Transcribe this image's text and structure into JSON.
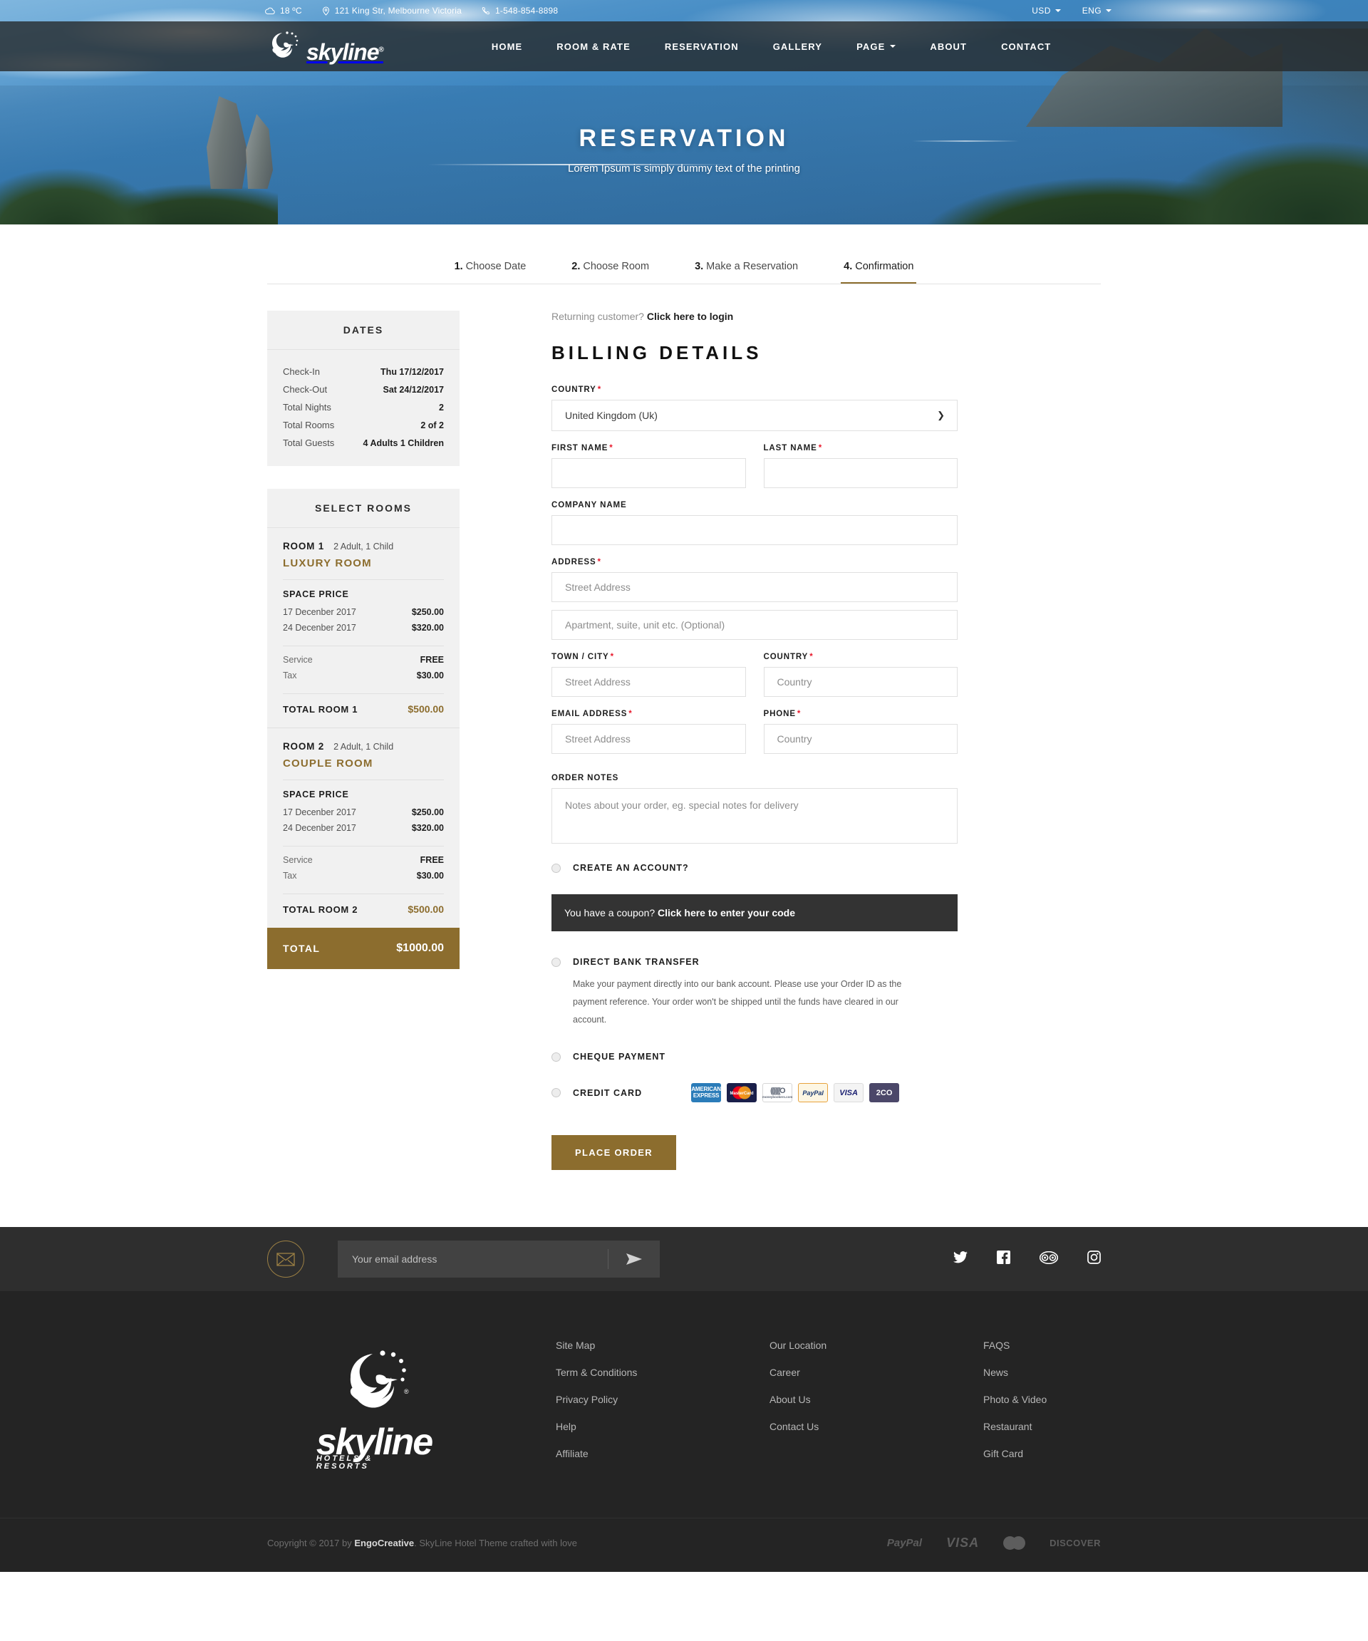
{
  "topbar": {
    "weather": "18 ºC",
    "address": "121 King Str, Melbourne Victoria",
    "phone": "1-548-854-8898",
    "currency": "USD",
    "language": "ENG"
  },
  "brand": {
    "name": "skyline",
    "registered": "®",
    "tagline": "HOTELS & RESORTS"
  },
  "nav": {
    "items": [
      {
        "label": "HOME",
        "has_caret": false
      },
      {
        "label": "ROOM & RATE",
        "has_caret": false
      },
      {
        "label": "RESERVATION",
        "has_caret": false
      },
      {
        "label": "GALLERY",
        "has_caret": false
      },
      {
        "label": "PAGE",
        "has_caret": true
      },
      {
        "label": "ABOUT",
        "has_caret": false
      },
      {
        "label": "CONTACT",
        "has_caret": false
      }
    ]
  },
  "hero": {
    "title": "RESERVATION",
    "subtitle": "Lorem Ipsum is simply dummy text of the printing"
  },
  "steps": [
    {
      "num": "1.",
      "label": "Choose Date",
      "active": false
    },
    {
      "num": "2.",
      "label": "Choose Room",
      "active": false
    },
    {
      "num": "3.",
      "label": "Make a Reservation",
      "active": false
    },
    {
      "num": "4.",
      "label": "Confirmation",
      "active": true
    }
  ],
  "dates_panel": {
    "title": "DATES",
    "rows": [
      {
        "label": "Check-In",
        "value": "Thu 17/12/2017"
      },
      {
        "label": "Check-Out",
        "value": "Sat 24/12/2017"
      },
      {
        "label": "Total Nights",
        "value": "2"
      },
      {
        "label": "Total Rooms",
        "value": "2 of 2"
      },
      {
        "label": "Total Guests",
        "value": "4 Adults 1 Children"
      }
    ]
  },
  "rooms_panel": {
    "title": "SELECT ROOMS",
    "space_price_label": "SPACE PRICE",
    "rooms": [
      {
        "number": "ROOM 1",
        "occupancy": "2 Adult, 1 Child",
        "name": "LUXURY ROOM",
        "nights": [
          {
            "date": "17 Decenber 2017",
            "price": "$250.00"
          },
          {
            "date": "24 Decenber 2017",
            "price": "$320.00"
          }
        ],
        "service_label": "Service",
        "service_value": "FREE",
        "tax_label": "Tax",
        "tax_value": "$30.00",
        "total_label": "TOTAL ROOM 1",
        "total_value": "$500.00"
      },
      {
        "number": "ROOM 2",
        "occupancy": "2 Adult, 1 Child",
        "name": "COUPLE ROOM",
        "nights": [
          {
            "date": "17 Decenber 2017",
            "price": "$250.00"
          },
          {
            "date": "24 Decenber 2017",
            "price": "$320.00"
          }
        ],
        "service_label": "Service",
        "service_value": "FREE",
        "tax_label": "Tax",
        "tax_value": "$30.00",
        "total_label": "TOTAL ROOM 2",
        "total_value": "$500.00"
      }
    ],
    "grand_total_label": "TOTAL",
    "grand_total_value": "$1000.00"
  },
  "billing": {
    "returning_prefix": "Returning customer? ",
    "returning_link": "Click here to login",
    "title": "BILLING DETAILS",
    "country_label": "COUNTRY",
    "country_value": "United Kingdom (Uk)",
    "country_options": [
      "United Kingdom (Uk)"
    ],
    "first_name_label": "FIRST NAME",
    "first_name_value": "",
    "last_name_label": "LAST NAME",
    "last_name_value": "",
    "company_label": "COMPANY NAME",
    "company_value": "",
    "address_label": "ADDRESS",
    "address_placeholder": "Street Address",
    "address2_placeholder": "Apartment, suite, unit etc. (Optional)",
    "town_label": "TOWN / CITY",
    "town_placeholder": "Street Address",
    "country2_label": "COUNTRY",
    "country2_placeholder": "Country",
    "email_label": "EMAIL ADDRESS",
    "email_placeholder": "Street Address",
    "phone_label": "PHONE",
    "phone_placeholder": "Country",
    "notes_label": "ORDER NOTES",
    "notes_placeholder": "Notes about your order, eg. special notes for delivery",
    "create_account_label": "CREATE AN ACCOUNT?",
    "coupon_prefix": "You have a coupon? ",
    "coupon_link": "Click here to enter your code",
    "place_order_label": "PLACE ORDER"
  },
  "payments": {
    "bank_label": "DIRECT BANK TRANSFER",
    "bank_desc": "Make your payment directly into our bank account. Please use your Order ID as the payment reference. Your order won't be shipped until the funds have cleared in our account.",
    "cheque_label": "CHEQUE PAYMENT",
    "credit_label": "CREDIT CARD",
    "card_icons": [
      {
        "name": "amex-icon",
        "line1": "AMERICAN",
        "line2": "EXPRESS"
      },
      {
        "name": "mastercard-icon",
        "line1": "MasterCard",
        "line2": ""
      },
      {
        "name": "moneybookers-icon",
        "line1": "((((((O",
        "line2": "moneybookers.com"
      },
      {
        "name": "paypal-icon",
        "line1": "PayPal",
        "line2": ""
      },
      {
        "name": "visa-icon",
        "line1": "VISA",
        "line2": ""
      },
      {
        "name": "2checkout-icon",
        "line1": "2CO",
        "line2": ""
      }
    ]
  },
  "newsletter": {
    "placeholder": "Your email address",
    "value": "",
    "socials": [
      "twitter-icon",
      "facebook-icon",
      "tripadvisor-icon",
      "instagram-icon"
    ]
  },
  "footer": {
    "columns": [
      {
        "links": [
          "Site Map",
          "Term & Conditions",
          "Privacy Policy",
          "Help",
          "Affiliate"
        ]
      },
      {
        "links": [
          "Our Location",
          "Career",
          "About Us",
          "Contact Us"
        ]
      },
      {
        "links": [
          "FAQS",
          "News",
          "Photo & Video",
          "Restaurant",
          "Gift Card"
        ]
      }
    ],
    "copyright_pre": "Copyright © 2017 by ",
    "copyright_brand": "EngoCreative",
    "copyright_post": ". SkyLine Hotel Theme crafted with love",
    "payment_logos": [
      "PayPal",
      "VISA",
      "MasterCard",
      "DISCOVER"
    ]
  },
  "colors": {
    "accent": "#8c6d2e",
    "dark": "#2e2e2e",
    "footer": "#242424",
    "required": "#e8192c"
  }
}
